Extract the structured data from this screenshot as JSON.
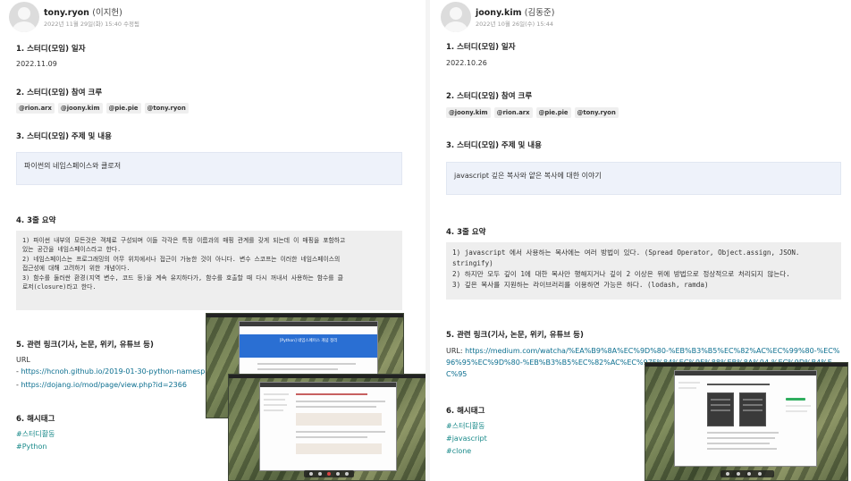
{
  "left_post": {
    "author_name": "tony.ryon",
    "author_realname": "(이지헌)",
    "meta": "2022년 11월 29일(화) 15:40 수정됨",
    "date_heading": "1. 스터디(모임) 일자",
    "date_value": "2022.11.09",
    "crew_heading": "2. 스터디(모임) 참여 크루",
    "crew": [
      "@rion.arx",
      "@joony.kim",
      "@pie.pie",
      "@tony.ryon"
    ],
    "topic_heading": "3. 스터디(모임) 주제 및 내용",
    "topic": "파이썬의 네임스페이스와 클로저",
    "summary_heading": "4. 3줄 요약",
    "summary": [
      "1) 파이썬 내부의 모든것은 객체로 구성되며 이들 각각은 특정 이름과의 매핑 관계를 갖게 되는데 이 매핑을 포함하고\n있는 공간을 네임스페이스라고 한다.",
      "2) 네임스페이스는 프로그래밍의 어무 위치에서나 접근이 가능한 것이 아니다. 변수 스코프는 이러한 네임스페이스의\n접근성에 대해 고려하기 위한 개념이다.",
      "3) 함수를 둘러싼 환경(지역 변수, 코드 등)을 계속 유지하다가, 함수를 호출할 때 다시 꺼내서 사용하는 함수를 클\n로저(closure)라고 한다."
    ],
    "links_heading": "5. 관련 링크(기사, 논문, 위키, 유튜브 등)",
    "url_label": "URL",
    "links": [
      "https://hcnoh.github.io/2019-01-30-python-namespac",
      "https://dojang.io/mod/page/view.php?id=2366"
    ],
    "link_prefix": "- ",
    "hashtag_heading": "6. 해시태그",
    "hashtags": [
      "#스터디활동",
      "#Python"
    ],
    "screenshot_banner": "[Python] 네임스페이스 개념 정리"
  },
  "right_post": {
    "author_name": "joony.kim",
    "author_realname": "(김동준)",
    "meta": "2022년 10월 26일(수) 15:44",
    "date_heading": "1. 스터디(모임) 일자",
    "date_value": "2022.10.26",
    "crew_heading": "2. 스터디(모임) 참여 크루",
    "crew": [
      "@joony.kim",
      "@rion.arx",
      "@pie.pie",
      "@tony.ryon"
    ],
    "topic_heading": "3. 스터디(모임) 주제 및 내용",
    "topic": "javascript 깊은 복사와 얕은 복사에 대한 이야기",
    "summary_heading": "4. 3줄 요약",
    "summary": [
      "1) javascript 에서 사용하는 복사에는 여러 방법이 있다. (Spread Operator, Object.assign, JSON.\nstringify)",
      "2) 하지만 모두 깊이 1에 대한 복사만 행해지거나 깊이 2 이상은 위에 방법으로 정상적으로 처리되지 않는다.",
      "3) 깊은 복사를 지원하는 라이브러리를 이용하면 가능은 하다. (lodash, ramda)"
    ],
    "links_heading": "5. 관련 링크(기사, 논문, 위키, 유튜브 등)",
    "url_label": "URL: ",
    "url": "https://medium.com/watcha/%EA%B9%8A%EC%9D%80-%EB%B3%B5%EC%82%AC%EC%99%80-%EC%96%95%EC%9D%80-%EB%B3%B5%EC%82%AC%EC%97F%84%EC%9E%88%EB%8A%94-%EC%9D%B4%EC%95",
    "hashtag_heading": "6. 해시태그",
    "hashtags": [
      "#스터디활동",
      "#javascript",
      "#clone"
    ]
  },
  "colors": {
    "link": "#0b6e8f",
    "hashtag": "#1a8a8a",
    "tag_bg": "#efefef",
    "topic_bg": "#eef2fa",
    "summary_bg": "#eeeeee"
  },
  "icons": [
    "user-avatar-icon"
  ]
}
